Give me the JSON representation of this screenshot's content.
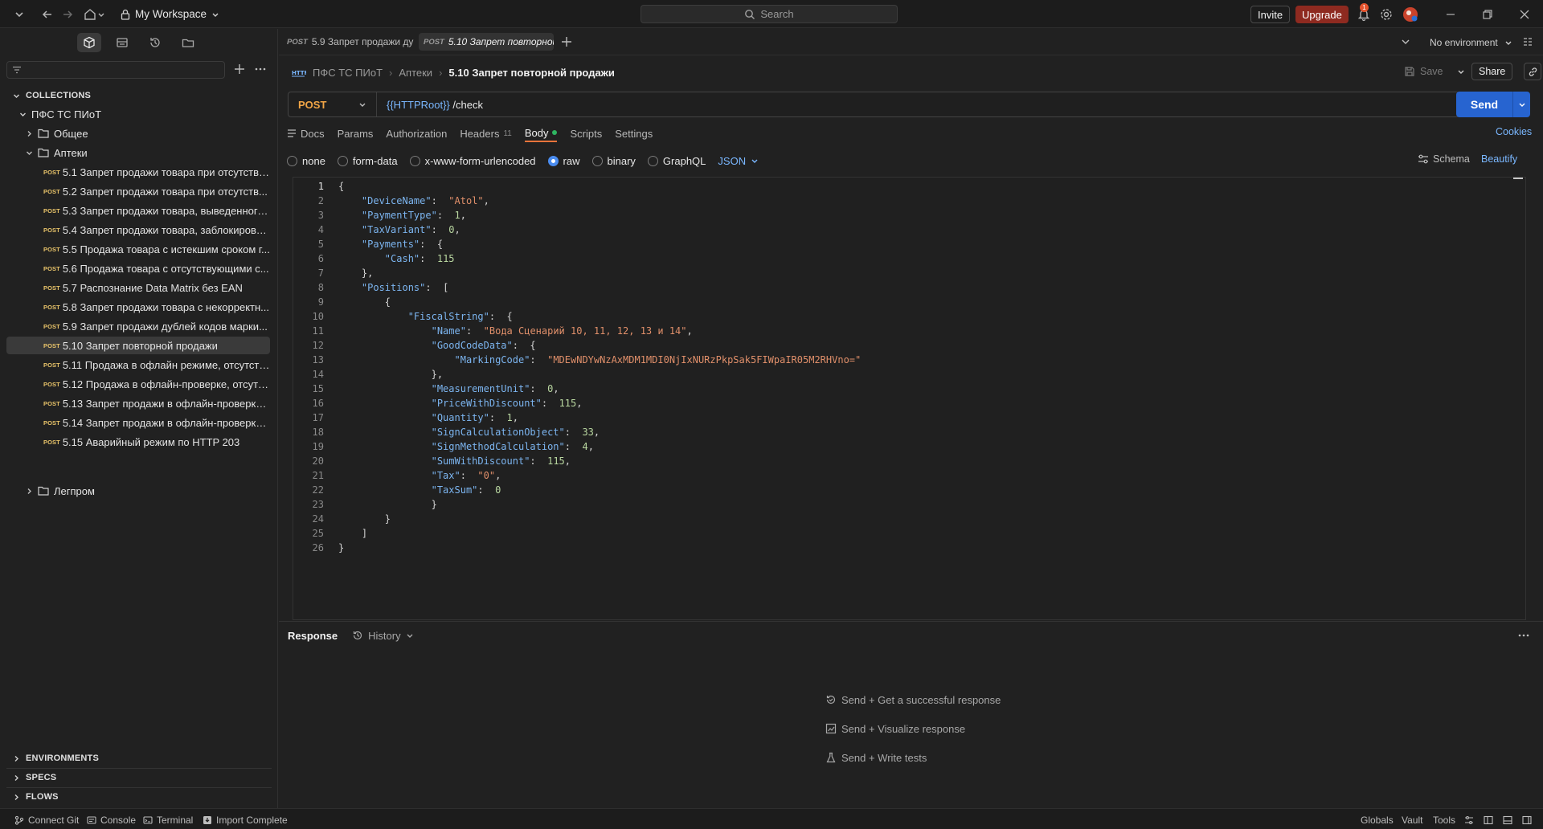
{
  "topbar": {
    "workspace": "My Workspace",
    "search_placeholder": "Search",
    "invite": "Invite",
    "upgrade": "Upgrade",
    "notification_count": "1"
  },
  "sidebar": {
    "collections_label": "COLLECTIONS",
    "collection_name": "ПФС ТС ПИоТ",
    "folders": {
      "general": "Общее",
      "pharmacies": "Аптеки",
      "light_industry": "Легпром"
    },
    "method_tag": "POST",
    "requests": [
      "5.1 Запрет продажи товара при отсутстви...",
      "5.2 Запрет продажи товара при отсутств...",
      "5.3 Запрет продажи товара, выведенного...",
      "5.4 Запрет продажи товара, заблокирова...",
      "5.5 Продажа товара с истекшим сроком г...",
      "5.6 Продажа товара с отсутствующими с...",
      "5.7 Распознание Data Matrix без EAN",
      "5.8 Запрет продажи товара с некорректн...",
      "5.9 Запрет продажи дублей кодов марки...",
      "5.10 Запрет повторной продажи",
      "5.11 Продажа в офлайн режиме, отсутств...",
      "5.12 Продажа в офлайн-проверке, отсутс...",
      "5.13 Запрет продажи в офлайн-проверке,...",
      "5.14 Запрет продажи в офлайн-проверке ...",
      "5.15 Аварийный режим по HTTP 203"
    ],
    "active_request_index": 9,
    "bottom_sections": [
      "ENVIRONMENTS",
      "SPECS",
      "FLOWS"
    ]
  },
  "tabs": {
    "items": [
      {
        "method": "POST",
        "title": "5.9 Запрет продажи ду"
      },
      {
        "method": "POST",
        "title": "5.10 Запрет повторной"
      }
    ],
    "environment": "No environment"
  },
  "request": {
    "breadcrumb": [
      "ПФС ТС ПИоТ",
      "Аптеки",
      "5.10 Запрет повторной продажи"
    ],
    "save_label": "Save",
    "share_label": "Share",
    "method": "POST",
    "url_var": "{{HTTPRoot}}",
    "url_path": " /check",
    "send_label": "Send",
    "tabs": [
      "Docs",
      "Params",
      "Authorization",
      "Headers",
      "Body",
      "Scripts",
      "Settings"
    ],
    "headers_count": "11",
    "cookies_label": "Cookies",
    "body_types": [
      "none",
      "form-data",
      "x-www-form-urlencoded",
      "raw",
      "binary",
      "GraphQL"
    ],
    "body_format": "JSON",
    "schema_label": "Schema",
    "beautify_label": "Beautify"
  },
  "body_lines": [
    "{",
    "    \"DeviceName\":  \"Atol\",",
    "    \"PaymentType\":  1,",
    "    \"TaxVariant\":  0,",
    "    \"Payments\":  {",
    "        \"Cash\":  115",
    "    },",
    "    \"Positions\":  [",
    "        {",
    "            \"FiscalString\":  {",
    "                \"Name\":  \"Вода Сценарий 10, 11, 12, 13 и 14\",",
    "                \"GoodCodeData\":  {",
    "                    \"MarkingCode\":  \"MDEwNDYwNzAxMDM1MDI0NjIxNURzPkpSak5FIWpaIR05M2RHVno=\"",
    "                },",
    "                \"MeasurementUnit\":  0,",
    "                \"PriceWithDiscount\":  115,",
    "                \"Quantity\":  1,",
    "                \"SignCalculationObject\":  33,",
    "                \"SignMethodCalculation\":  4,",
    "                \"SumWithDiscount\":  115,",
    "                \"Tax\":  \"0\",",
    "                \"TaxSum\":  0",
    "                }",
    "        }",
    "    ]",
    "}"
  ],
  "response": {
    "label": "Response",
    "history": "History",
    "hints": [
      "Send + Get a successful response",
      "Send + Visualize response",
      "Send + Write tests"
    ]
  },
  "statusbar": {
    "left": [
      "Connect Git",
      "Console",
      "Terminal",
      "Import Complete"
    ],
    "right": [
      "Globals",
      "Vault",
      "Tools"
    ]
  },
  "colors": {
    "accent_send": "#2764d0",
    "upgrade": "#8e2a20",
    "method_post": "#f1a546",
    "active_tab_underline": "#e8743b"
  }
}
